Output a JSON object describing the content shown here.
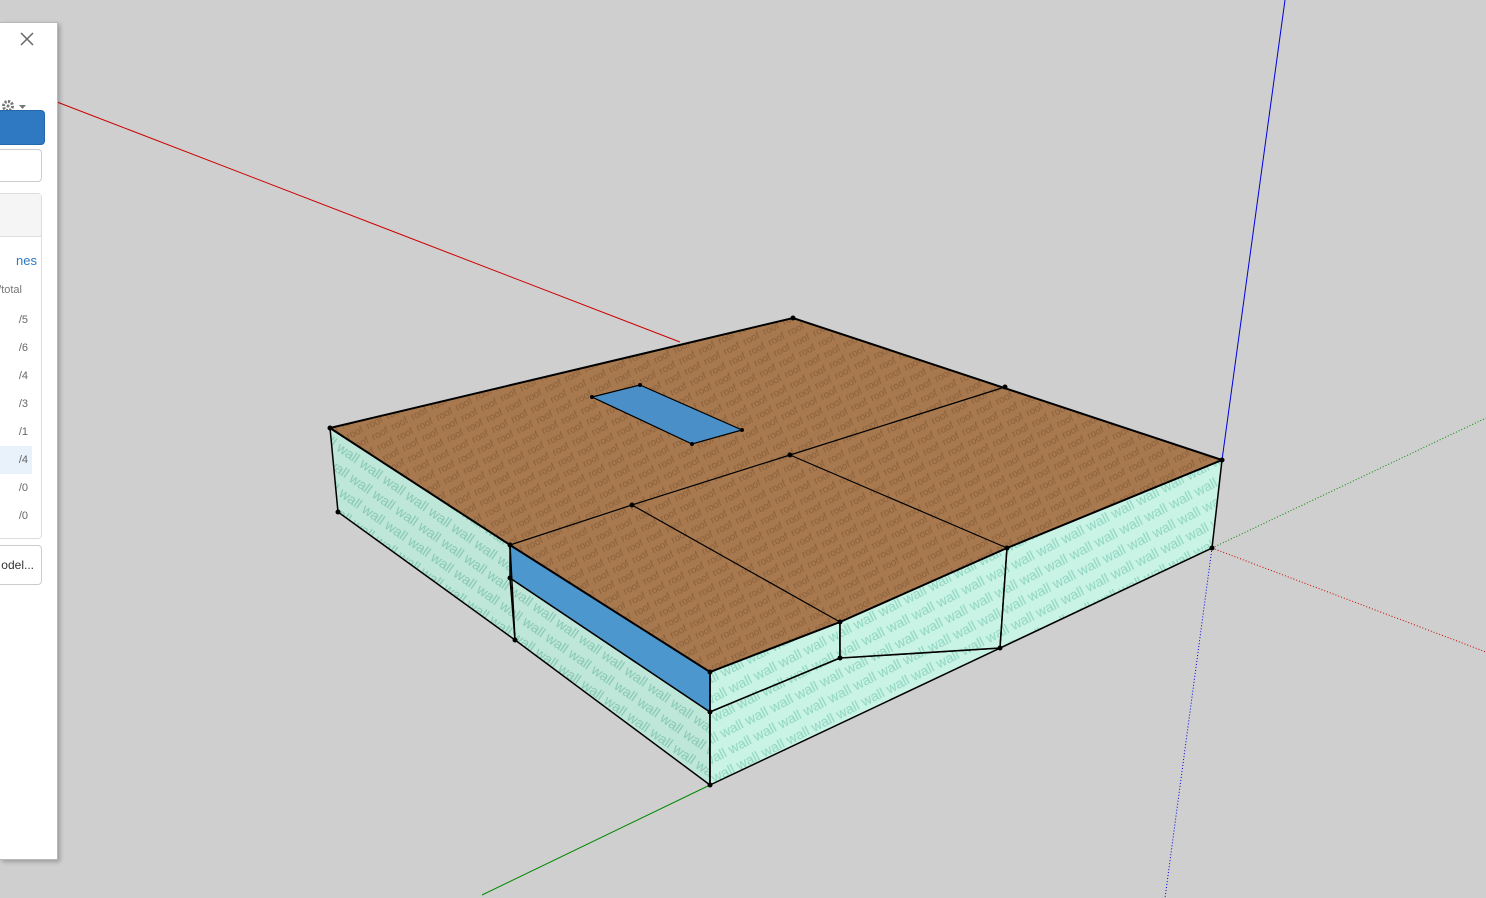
{
  "colors": {
    "background": "#cfcfcf",
    "axis_red": "#cc0000",
    "axis_green": "#008800",
    "axis_blue": "#0000dd",
    "roof_brown": "#a67c52",
    "wall_mint": "#c6f1e3",
    "window_blue": "#4a8fc8",
    "accent": "#2f79c3"
  },
  "texture_labels": {
    "roof": "roof",
    "wall": "wall"
  },
  "panel": {
    "icons": {
      "close": "close-icon",
      "gear": "gear-icon",
      "caret": "caret-down-icon"
    },
    "link_text": "nes",
    "column_header": "/total",
    "rows": [
      "/5",
      "/6",
      "/4",
      "/3",
      "/1",
      "/4",
      "/0",
      "/0"
    ],
    "highlighted_row": 5,
    "bottom_button": "odel..."
  }
}
